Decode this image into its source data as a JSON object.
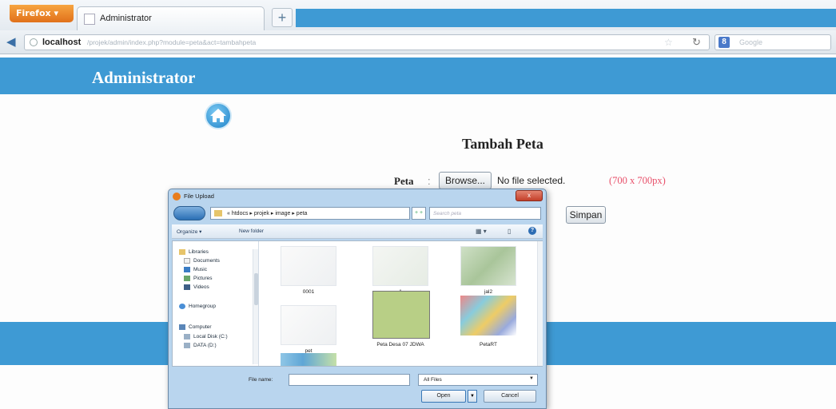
{
  "browser": {
    "app_button": "Firefox",
    "tab_title": "Administrator",
    "new_tab": "+",
    "url_host": "localhost",
    "url_path": "/projek/admin/index.php?module=peta&act=tambahpeta",
    "search_placeholder": "Google",
    "search_engine_icon": "google-icon"
  },
  "page": {
    "site_title": "Administrator",
    "heading": "Tambah Peta",
    "field_label": "Peta",
    "colon": ":",
    "browse_label": "Browse...",
    "file_status": "No file selected.",
    "size_hint": "(700 x 700px)",
    "submit_label": "Simpan",
    "header_color": "#3e9ad4"
  },
  "dialog": {
    "title": "File Upload",
    "close": "x",
    "path": "« htdocs ▸ projek ▸ image ▸ peta",
    "refresh": "+ +",
    "search_placeholder": "Search peta",
    "organize": "Organize ▾",
    "new_folder": "New folder",
    "nav": [
      {
        "label": "Libraries",
        "icon": "library-icon"
      },
      {
        "label": "Documents",
        "icon": "documents-icon"
      },
      {
        "label": "Music",
        "icon": "music-icon"
      },
      {
        "label": "Pictures",
        "icon": "pictures-icon"
      },
      {
        "label": "Videos",
        "icon": "videos-icon"
      },
      {
        "label": "Homegroup",
        "icon": "homegroup-icon"
      },
      {
        "label": "Computer",
        "icon": "computer-icon"
      },
      {
        "label": "Local Disk (C:)",
        "icon": "drive-icon"
      },
      {
        "label": "DATA (D:)",
        "icon": "drive-icon"
      }
    ],
    "files": [
      {
        "name": "0001"
      },
      {
        "name": "1"
      },
      {
        "name": "jal2"
      },
      {
        "name": "pet"
      },
      {
        "name": "Peta Desa 07 JDWA"
      },
      {
        "name": "PetaRT"
      }
    ],
    "file_name_label": "File name:",
    "file_name_value": "",
    "filter": "All Files",
    "open": "Open",
    "cancel": "Cancel"
  }
}
